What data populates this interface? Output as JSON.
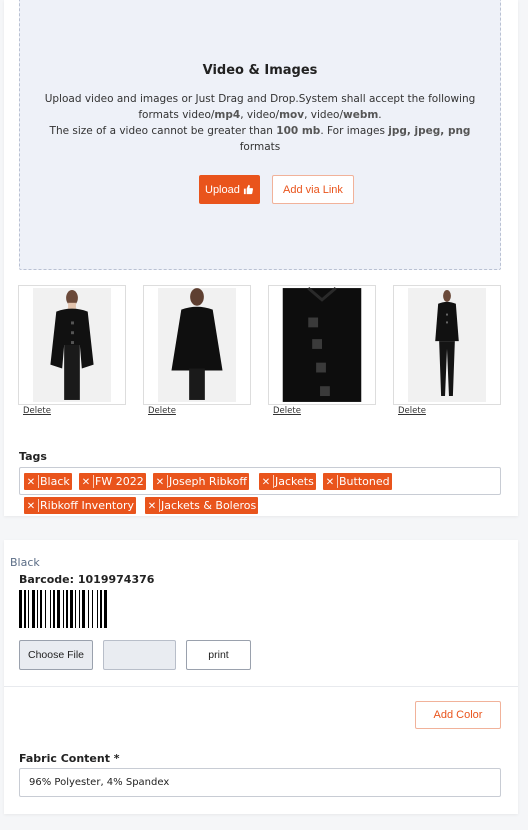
{
  "media": {
    "title": "Video & Images",
    "desc_line1": "Upload video and images or Just Drag and Drop.System shall accept the following",
    "formats_prefix": "formats video/",
    "fmt_mp4": "mp4",
    "sep1": ", video/",
    "fmt_mov": "mov",
    "sep2": ", video/",
    "fmt_webm": "webm",
    "period": ".",
    "size_prefix": "The size of a video cannot be greater than ",
    "size_limit": "100 mb",
    "images_prefix": ". For images ",
    "img_formats": "jpg, jpeg, png",
    "formats_word": "formats",
    "upload_label": "Upload",
    "upload_icon": "thumbs-up-icon",
    "link_label": "Add via Link"
  },
  "images": [
    {
      "delete_label": "Delete"
    },
    {
      "delete_label": "Delete"
    },
    {
      "delete_label": "Delete"
    },
    {
      "delete_label": "Delete"
    }
  ],
  "tags": {
    "label": "Tags",
    "items": [
      "Black",
      "FW 2022",
      "Joseph Ribkoff",
      "Jackets",
      "Buttoned",
      "Ribkoff Inventory",
      "Jackets & Boleros"
    ],
    "remove_icon": "close-icon"
  },
  "variant": {
    "color_name": "Black",
    "barcode_label": "Barcode: 1019974376",
    "choose_file_label": "Choose File",
    "print_label": "print",
    "add_color_label": "Add Color",
    "fabric_label": "Fabric Content *",
    "fabric_value": "96% Polyester, 4% Spandex"
  },
  "colors": {
    "accent": "#e9541c",
    "dropzone_bg": "#eef1f8"
  }
}
